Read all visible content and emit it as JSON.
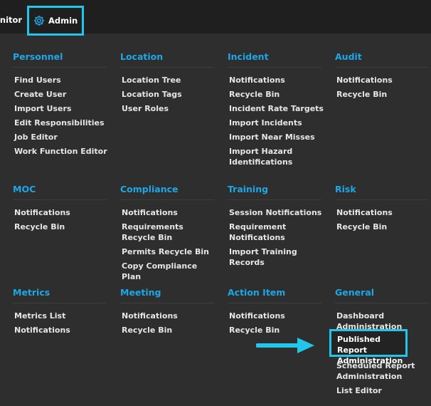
{
  "nav": {
    "monitor_label": "onitor",
    "admin_label": "Admin"
  },
  "sections": {
    "personnel": {
      "title": "Personnel",
      "items": [
        "Find Users",
        "Create User",
        "Import Users",
        "Edit Responsibilities",
        "Job Editor",
        "Work Function Editor"
      ]
    },
    "location": {
      "title": "Location",
      "items": [
        "Location Tree",
        "Location Tags",
        "User Roles"
      ]
    },
    "incident": {
      "title": "Incident",
      "items": [
        "Notifications",
        "Recycle Bin",
        "Incident Rate Targets",
        "Import Incidents",
        "Import Near Misses",
        "Import Hazard Identifications"
      ]
    },
    "audit": {
      "title": "Audit",
      "items": [
        "Notifications",
        "Recycle Bin"
      ]
    },
    "moc": {
      "title": "MOC",
      "items": [
        "Notifications",
        "Recycle Bin"
      ]
    },
    "compliance": {
      "title": "Compliance",
      "items": [
        "Notifications",
        "Requirements Recycle Bin",
        "Permits Recycle Bin",
        "Copy Compliance Plan"
      ]
    },
    "training": {
      "title": "Training",
      "items": [
        "Session Notifications",
        "Requirement Notifications",
        "Import Training Records"
      ]
    },
    "risk": {
      "title": "Risk",
      "items": [
        "Notifications",
        "Recycle Bin"
      ]
    },
    "metrics": {
      "title": "Metrics",
      "items": [
        "Metrics List",
        "Notifications"
      ]
    },
    "meeting": {
      "title": "Meeting",
      "items": [
        "Notifications",
        "Recycle Bin"
      ]
    },
    "action_item": {
      "title": "Action Item",
      "items": [
        "Notifications",
        "Recycle Bin"
      ]
    },
    "general": {
      "title": "General",
      "items": [
        "Dashboard Administration",
        "Published Report Administration",
        "Scheduled Report Administration",
        "List Editor"
      ]
    }
  },
  "colors": {
    "accent": "#1ea7e6",
    "highlight": "#22c6ea"
  }
}
